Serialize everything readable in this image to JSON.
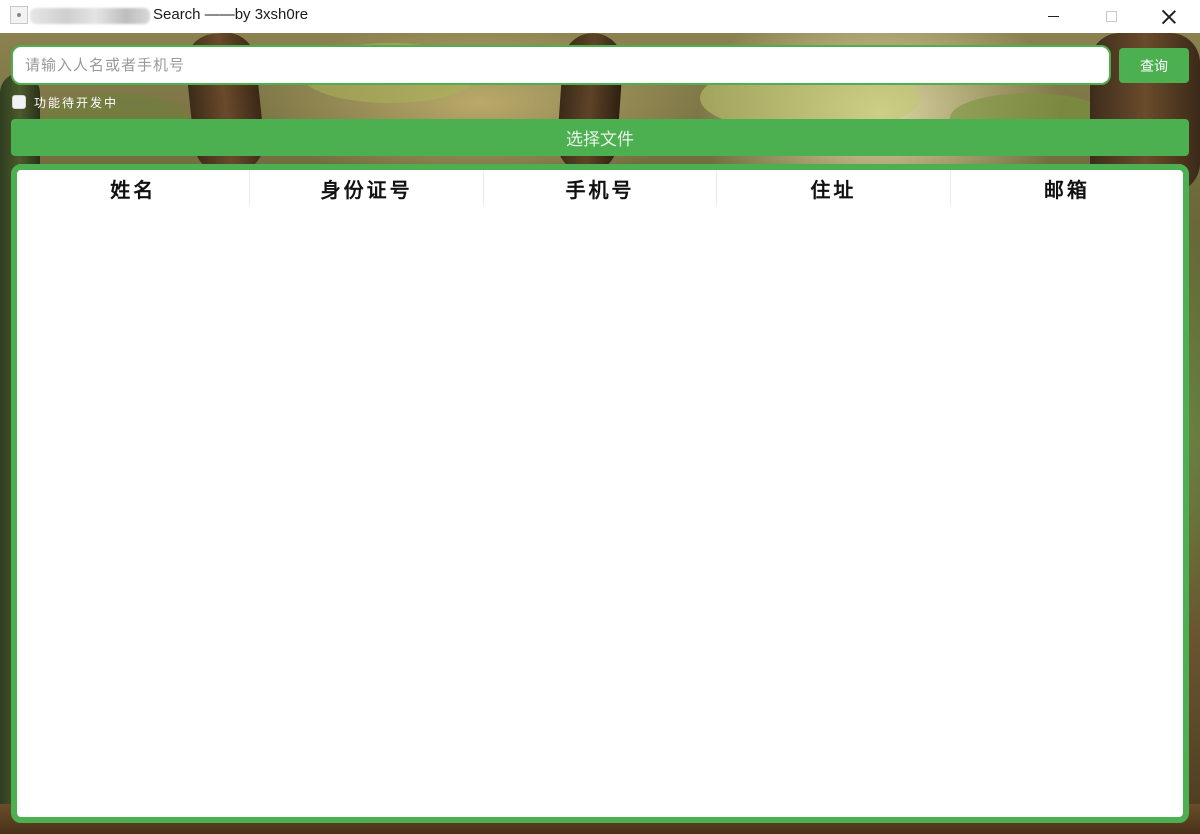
{
  "window": {
    "title_suffix": "Search ——by 3xsh0re",
    "icon": "app-icon",
    "controls": [
      "minimize-icon",
      "maximize-icon",
      "close-icon"
    ]
  },
  "search": {
    "placeholder": "请输入人名或者手机号",
    "value": "",
    "button_label": "查询"
  },
  "option": {
    "checkbox_label": "功能待开发中",
    "checked": false
  },
  "file_button_label": "选择文件",
  "table": {
    "columns": [
      "姓名",
      "身份证号",
      "手机号",
      "住址",
      "邮箱"
    ],
    "rows": []
  },
  "colors": {
    "accent": "#4caf50",
    "titlebar": "#ffffff"
  }
}
